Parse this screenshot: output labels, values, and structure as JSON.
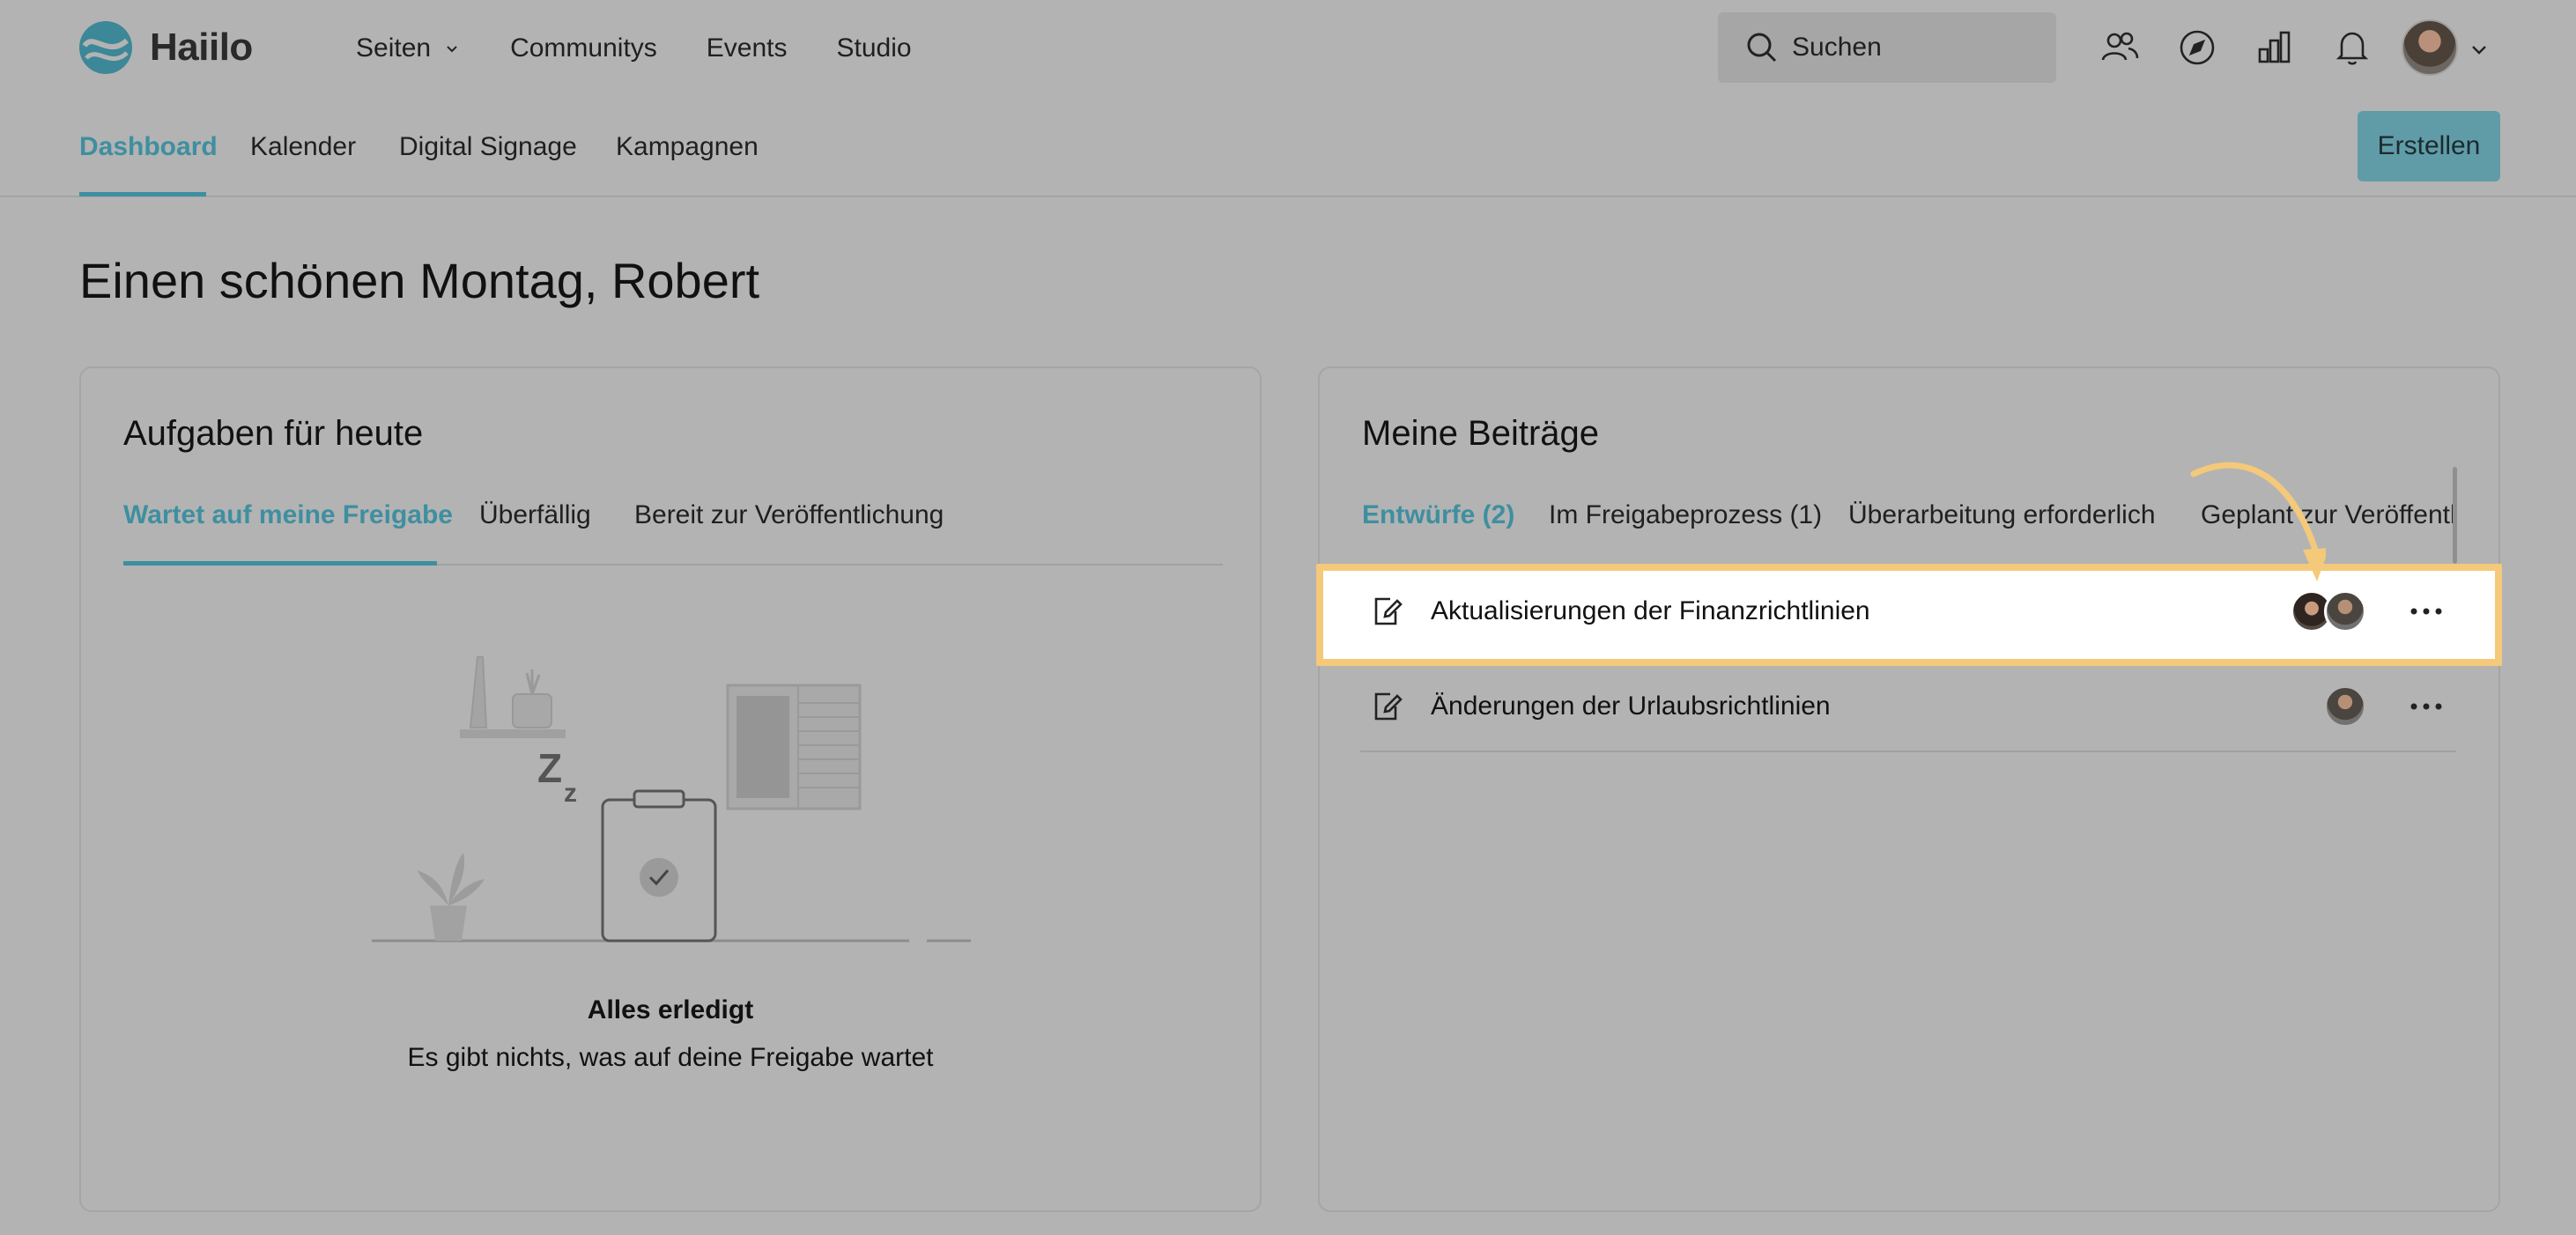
{
  "header": {
    "brand": "Haiilo",
    "nav": [
      {
        "label": "Seiten",
        "has_dropdown": true
      },
      {
        "label": "Communitys"
      },
      {
        "label": "Events"
      },
      {
        "label": "Studio"
      }
    ],
    "search_placeholder": "Suchen",
    "icons": [
      "people-icon",
      "compass-icon",
      "bar-chart-icon",
      "bell-icon"
    ]
  },
  "subnav": {
    "tabs": [
      {
        "label": "Dashboard",
        "active": true
      },
      {
        "label": "Kalender"
      },
      {
        "label": "Digital Signage"
      },
      {
        "label": "Kampagnen"
      }
    ],
    "create_label": "Erstellen"
  },
  "greeting": "Einen schönen Montag, Robert",
  "tasks": {
    "title": "Aufgaben für heute",
    "tabs": [
      {
        "label": "Wartet auf meine Freigabe",
        "active": true
      },
      {
        "label": "Überfällig"
      },
      {
        "label": "Bereit zur Veröffentlichung"
      }
    ],
    "empty_title": "Alles erledigt",
    "empty_text": "Es gibt nichts, was auf deine Freigabe wartet"
  },
  "posts": {
    "title": "Meine Beiträge",
    "tabs": [
      {
        "label": "Entwürfe (2)",
        "active": true
      },
      {
        "label": "Im Freigabeprozess (1)"
      },
      {
        "label": "Überarbeitung erforderlich"
      },
      {
        "label": "Geplant zur Veröffentlichung"
      }
    ],
    "items": [
      {
        "title": "Aktualisierungen der Finanzrichtlinien",
        "avatars": [
          "woman",
          "man"
        ],
        "highlighted": true
      },
      {
        "title": "Änderungen der Urlaubsrichtlinien",
        "avatars": [
          "man"
        ],
        "highlighted": false
      }
    ]
  },
  "colors": {
    "accent": "#3e8fa0",
    "highlight_border": "#f4c97a",
    "overlay_background": "#b3b3b3"
  }
}
